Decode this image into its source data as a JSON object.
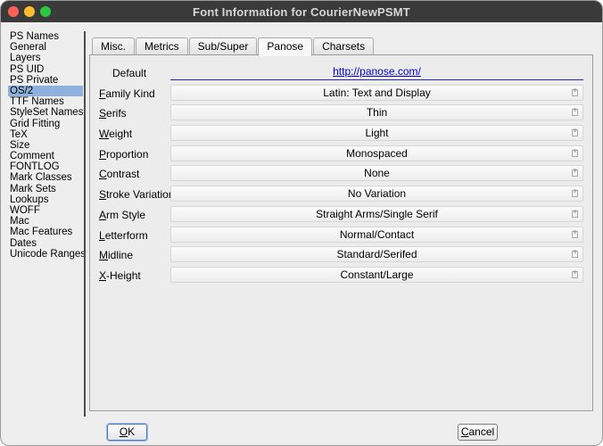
{
  "window": {
    "title": "Font Information for CourierNewPSMT"
  },
  "sidebar": {
    "items": [
      {
        "label": "PS Names"
      },
      {
        "label": "General"
      },
      {
        "label": "Layers"
      },
      {
        "label": "PS UID"
      },
      {
        "label": "PS Private"
      },
      {
        "label": "OS/2",
        "selected": true
      },
      {
        "label": "TTF Names"
      },
      {
        "label": "StyleSet Names"
      },
      {
        "label": "Grid Fitting"
      },
      {
        "label": "TeX"
      },
      {
        "label": "Size"
      },
      {
        "label": "Comment"
      },
      {
        "label": "FONTLOG"
      },
      {
        "label": "Mark Classes"
      },
      {
        "label": "Mark Sets"
      },
      {
        "label": "Lookups"
      },
      {
        "label": "WOFF"
      },
      {
        "label": "Mac"
      },
      {
        "label": "Mac Features"
      },
      {
        "label": "Dates"
      },
      {
        "label": "Unicode Ranges"
      }
    ]
  },
  "tabs": [
    {
      "label": "Misc."
    },
    {
      "label": "Metrics"
    },
    {
      "label": "Sub/Super"
    },
    {
      "label": "Panose",
      "active": true
    },
    {
      "label": "Charsets"
    }
  ],
  "panose": {
    "default_label": "Default",
    "default_link": "http://panose.com/",
    "rows": [
      {
        "label": "Family Kind",
        "value": "Latin: Text and Display"
      },
      {
        "label": "Serifs",
        "value": "Thin"
      },
      {
        "label": "Weight",
        "value": "Light"
      },
      {
        "label": "Proportion",
        "value": "Monospaced"
      },
      {
        "label": "Contrast",
        "value": "None"
      },
      {
        "label": "Stroke Variation",
        "value": "No Variation"
      },
      {
        "label": "Arm Style",
        "value": "Straight Arms/Single Serif"
      },
      {
        "label": "Letterform",
        "value": "Normal/Contact"
      },
      {
        "label": "Midline",
        "value": "Standard/Serifed"
      },
      {
        "label": "X-Height",
        "value": "Constant/Large"
      }
    ]
  },
  "buttons": {
    "ok": "OK",
    "cancel": "Cancel"
  },
  "colors": {
    "selection": "#8fb1de",
    "link": "#0000d8",
    "titlebar": "#3a3a3a"
  }
}
